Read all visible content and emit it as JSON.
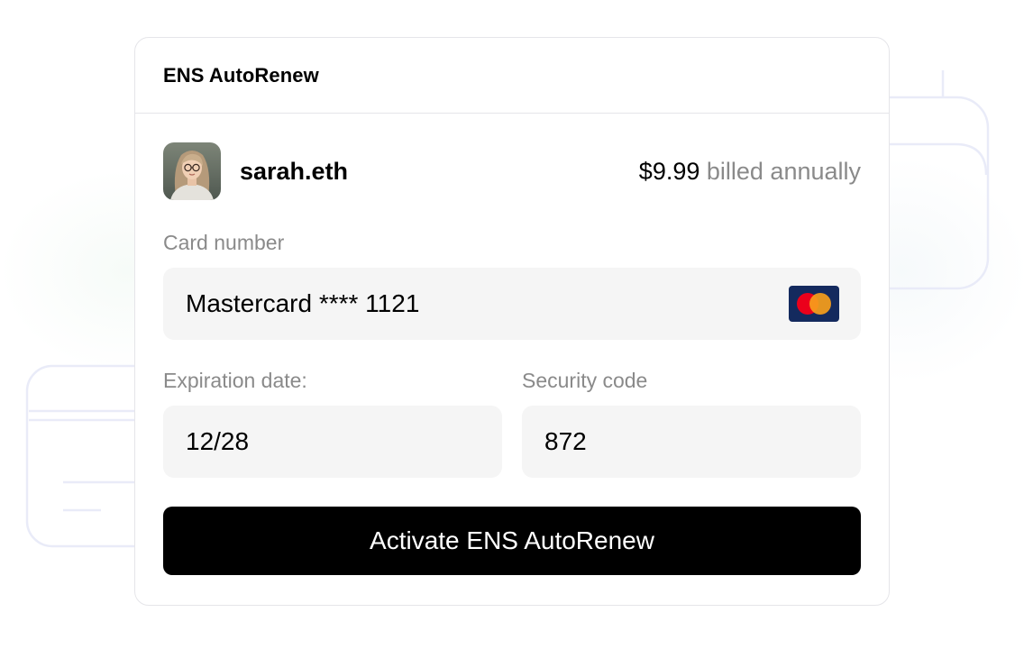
{
  "header": {
    "title": "ENS AutoRenew"
  },
  "user": {
    "name": "sarah.eth",
    "avatar_icon": "user-avatar-portrait"
  },
  "pricing": {
    "amount": "$9.99",
    "note": " billed annually"
  },
  "card_number": {
    "label": "Card number",
    "value": "Mastercard **** 1121",
    "brand_icon": "mastercard-icon"
  },
  "expiration": {
    "label": "Expiration date:",
    "value": "12/28"
  },
  "security": {
    "label": "Security code",
    "value": "872"
  },
  "actions": {
    "activate_label": "Activate ENS AutoRenew"
  },
  "colors": {
    "button_bg": "#000000",
    "muted_text": "#8a8a8a",
    "field_bg": "#f5f5f5",
    "border": "#e5e5e9",
    "decor_stroke": "#e9ebf8",
    "mastercard_bg": "#142a5e",
    "mastercard_red": "#eb001b",
    "mastercard_orange": "#f79e1b"
  }
}
